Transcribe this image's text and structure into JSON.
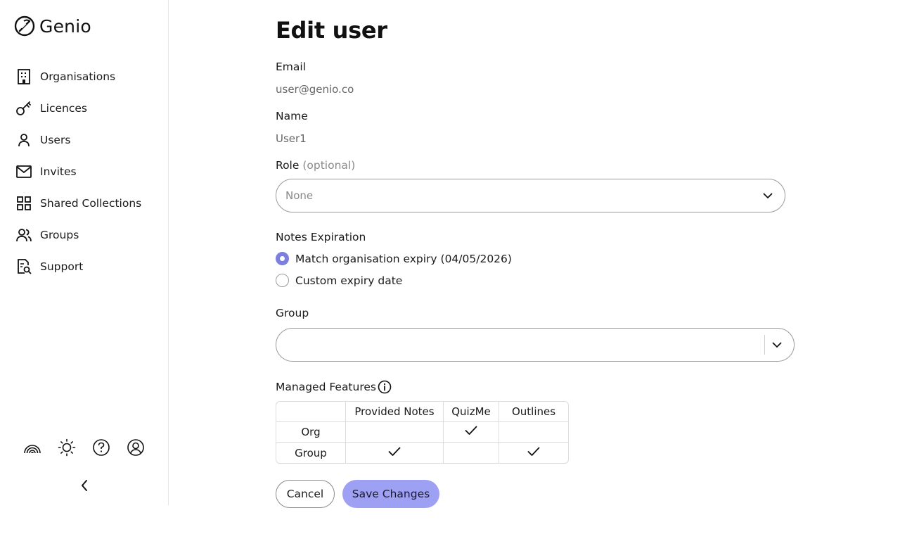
{
  "brand": {
    "name": "Genio",
    "logo_icon": "genio-logo-icon"
  },
  "sidebar": {
    "items": [
      {
        "label": "Organisations",
        "icon": "building-icon"
      },
      {
        "label": "Licences",
        "icon": "key-icon"
      },
      {
        "label": "Users",
        "icon": "user-icon"
      },
      {
        "label": "Invites",
        "icon": "mail-icon"
      },
      {
        "label": "Shared Collections",
        "icon": "grid-icon"
      },
      {
        "label": "Groups",
        "icon": "users-icon"
      },
      {
        "label": "Support",
        "icon": "document-search-icon"
      }
    ],
    "utilities": [
      "rainbow-icon",
      "sun-icon",
      "help-icon",
      "account-icon"
    ],
    "collapse_icon": "chevron-left-icon"
  },
  "page": {
    "title": "Edit user"
  },
  "form": {
    "email": {
      "label": "Email",
      "value": "user@genio.co"
    },
    "name": {
      "label": "Name",
      "value": "User1"
    },
    "role": {
      "label": "Role",
      "optional": "(optional)",
      "value": "None"
    },
    "notes_expiration": {
      "label": "Notes Expiration",
      "options": [
        {
          "label": "Match organisation expiry (04/05/2026)",
          "checked": true
        },
        {
          "label": "Custom expiry date",
          "checked": false
        }
      ]
    },
    "group": {
      "label": "Group",
      "value": ""
    },
    "managed_features": {
      "label": "Managed Features",
      "columns": [
        "",
        "Provided Notes",
        "QuizMe",
        "Outlines"
      ],
      "rows": [
        {
          "label": "Org",
          "values": [
            false,
            true,
            false
          ]
        },
        {
          "label": "Group",
          "values": [
            true,
            false,
            true
          ]
        }
      ]
    }
  },
  "actions": {
    "cancel_label": "Cancel",
    "save_label": "Save Changes"
  },
  "colors": {
    "accent": "#7b7fe0",
    "save_button": "#9da0f3",
    "border": "#9a9a9a"
  }
}
